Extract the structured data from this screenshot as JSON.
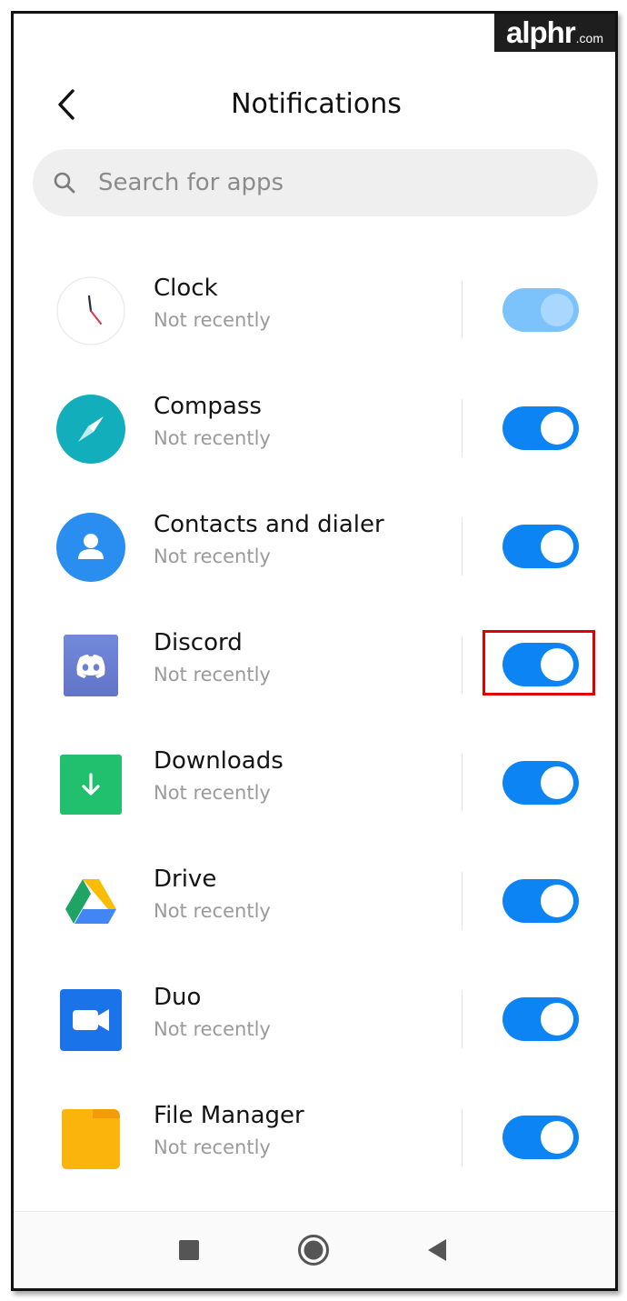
{
  "watermark": {
    "brand": "alphr",
    "domain": ".com"
  },
  "header": {
    "title": "Notifications"
  },
  "search": {
    "placeholder": "Search for apps"
  },
  "apps": [
    {
      "name": "Clock",
      "status": "Not recently",
      "enabled": true,
      "dimmed": true,
      "icon": "clock-icon"
    },
    {
      "name": "Compass",
      "status": "Not recently",
      "enabled": true,
      "icon": "compass-icon"
    },
    {
      "name": "Contacts and dialer",
      "status": "Not recently",
      "enabled": true,
      "icon": "contacts-icon"
    },
    {
      "name": "Discord",
      "status": "Not recently",
      "enabled": true,
      "icon": "discord-icon",
      "highlighted": true
    },
    {
      "name": "Downloads",
      "status": "Not recently",
      "enabled": true,
      "icon": "downloads-icon"
    },
    {
      "name": "Drive",
      "status": "Not recently",
      "enabled": true,
      "icon": "drive-icon"
    },
    {
      "name": "Duo",
      "status": "Not recently",
      "enabled": true,
      "icon": "duo-icon"
    },
    {
      "name": "File Manager",
      "status": "Not recently",
      "enabled": true,
      "icon": "file-manager-icon"
    }
  ],
  "colors": {
    "toggle_on": "#0c84f4",
    "toggle_dim": "#7cc3fb",
    "highlight": "#e00000"
  }
}
